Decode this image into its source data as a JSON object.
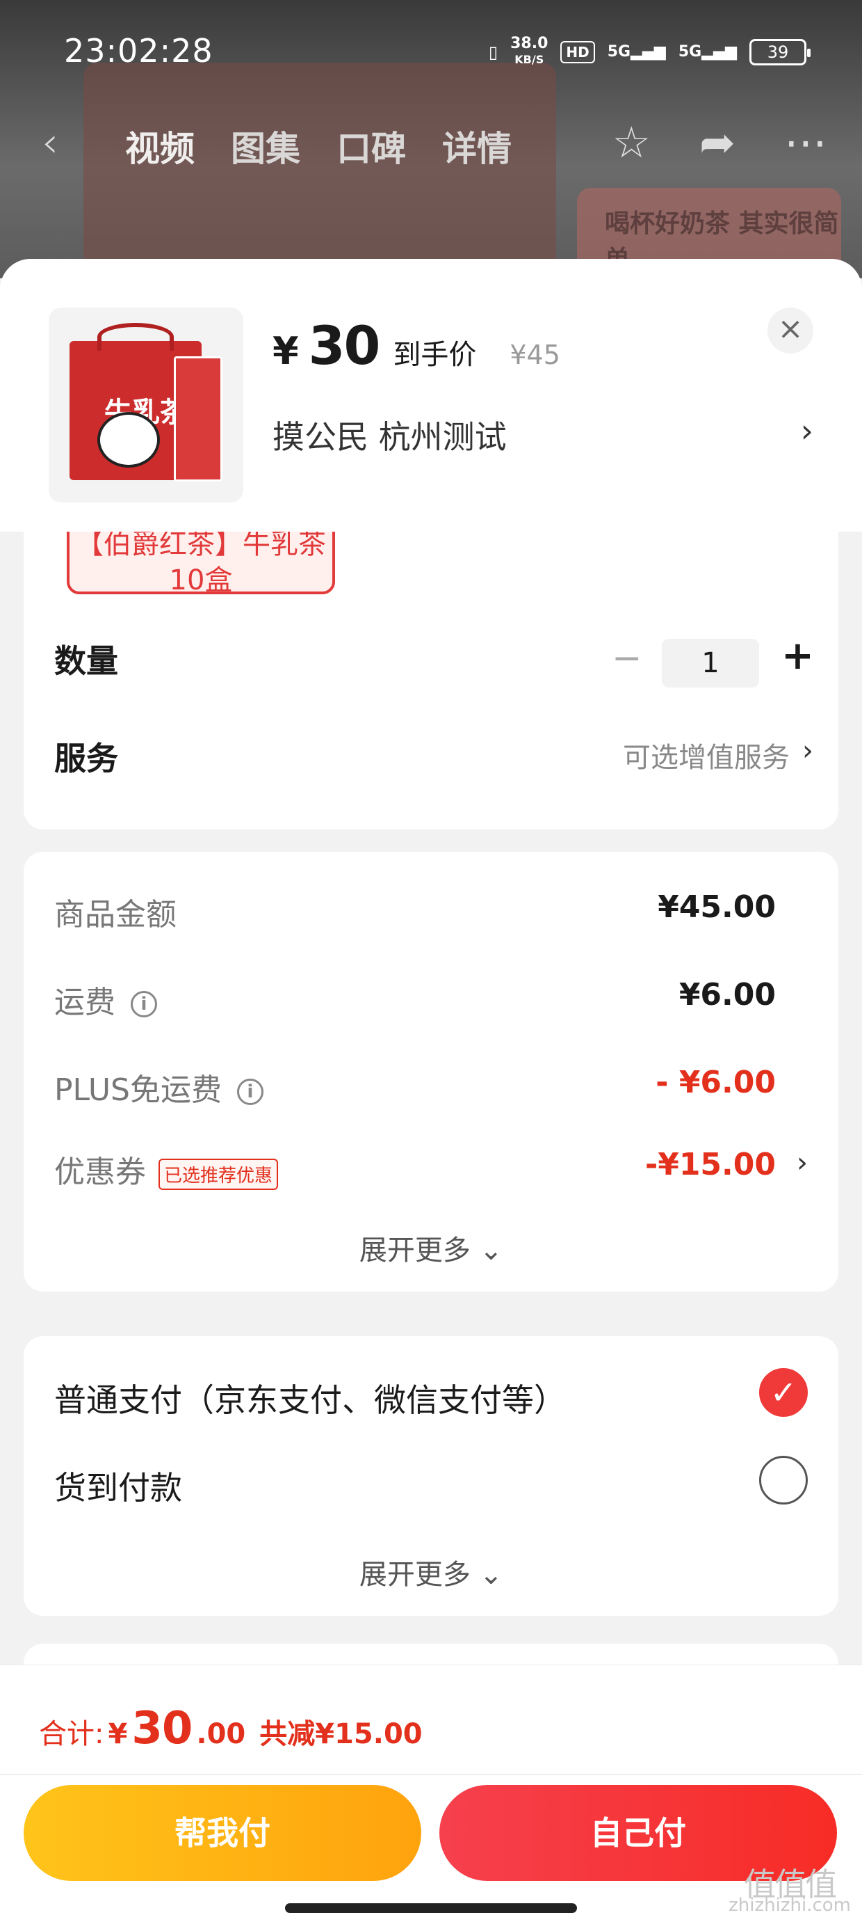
{
  "status_bar": {
    "time": "23:02:28",
    "net_speed_value": "38.0",
    "net_speed_unit": "KB/S",
    "hd_badge": "HD",
    "signal_1": "5G",
    "signal_2": "5G",
    "battery": "39"
  },
  "nav": {
    "back": "‹",
    "tabs": [
      "视频",
      "图集",
      "口碑",
      "详情"
    ],
    "active_tab_index": 0,
    "favorite_icon": "star-icon",
    "share_icon": "share-icon",
    "more_icon": "more-icon"
  },
  "background_banner": {
    "text": "喝杯好奶茶 其实很简单"
  },
  "product": {
    "thumbnail_text": "牛乳茶",
    "price_symbol": "¥",
    "price": "30",
    "price_tag": "到手价",
    "original_price": "¥45",
    "address": "摸公民  杭州测试",
    "address_arrow": "›",
    "close": "×"
  },
  "spec": {
    "selected_label": "【伯爵红茶】牛乳茶10盒"
  },
  "quantity": {
    "label": "数量",
    "minus": "−",
    "value": "1",
    "plus": "+"
  },
  "service": {
    "label": "服务",
    "hint": "可选增值服务",
    "arrow": "›"
  },
  "fees": {
    "goods_label": "商品金额",
    "goods_value": "¥45.00",
    "shipping_label": "运费",
    "shipping_value": "¥6.00",
    "plus_label": "PLUS免运费",
    "plus_value": "- ¥6.00",
    "coupon_label": "优惠券",
    "coupon_badge": "已选推荐优惠",
    "coupon_value": "-¥15.00",
    "coupon_arrow": "›",
    "info_glyph": "i",
    "expand": "展开更多 ⌄"
  },
  "payment": {
    "option_1": "普通支付（京东支付、微信支付等）",
    "option_1_checked": true,
    "option_2": "货到付款",
    "option_2_checked": false,
    "check_glyph": "✓",
    "expand": "展开更多 ⌄"
  },
  "footer": {
    "total_label": "合计:",
    "total_symbol": "¥",
    "total_int": "30",
    "total_dec": ".00",
    "total_save": "共减¥15.00",
    "help_pay": "帮我付",
    "self_pay": "自己付",
    "watermark_logo": "值值值",
    "watermark_site": "zhizhizhi.com"
  },
  "colors": {
    "accent_red": "#e3301c",
    "button_yellow": "#ffb31a",
    "button_red": "#f6404d"
  }
}
